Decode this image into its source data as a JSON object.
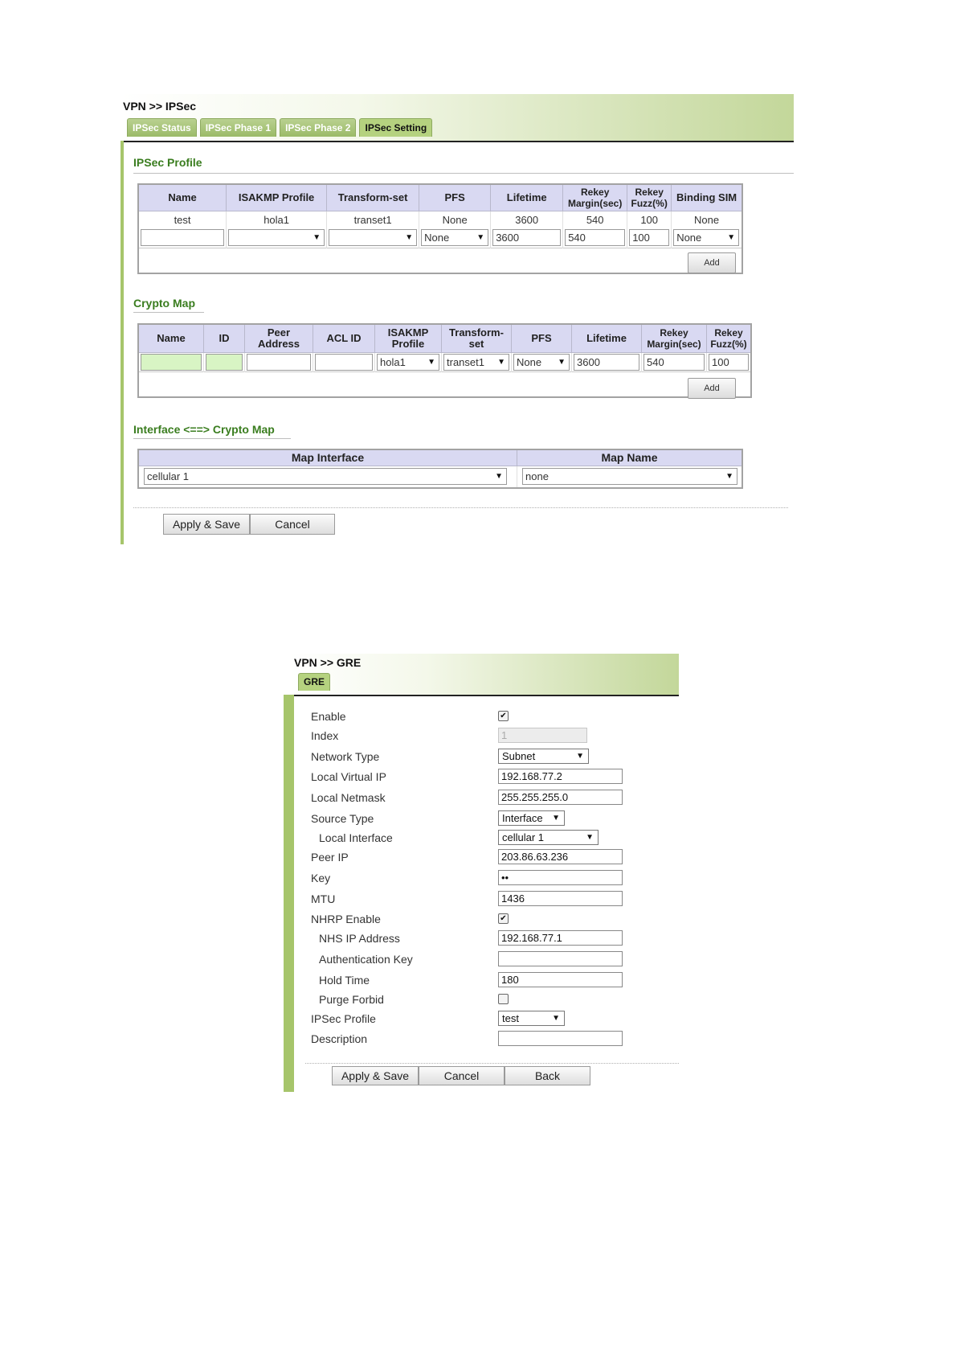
{
  "ipsec": {
    "breadcrumb": "VPN >> IPSec",
    "tabs": [
      {
        "label": "IPSec Status",
        "active": false
      },
      {
        "label": "IPSec Phase 1",
        "active": false
      },
      {
        "label": "IPSec Phase 2",
        "active": false
      },
      {
        "label": "IPSec Setting",
        "active": true
      }
    ],
    "profile": {
      "title": "IPSec Profile",
      "headers": [
        "Name",
        "ISAKMP Profile",
        "Transform-set",
        "PFS",
        "Lifetime",
        "Rekey Margin(sec)",
        "Rekey Fuzz(%)",
        "Binding SIM"
      ],
      "row": [
        "test",
        "hola1",
        "transet1",
        "None",
        "3600",
        "540",
        "100",
        "None"
      ],
      "inputs": {
        "name": "",
        "isakmp": "",
        "transform": "",
        "pfs": "None",
        "lifetime": "3600",
        "margin": "540",
        "fuzz": "100",
        "sim": "None"
      },
      "add_label": "Add"
    },
    "crypto": {
      "title": "Crypto Map",
      "headers": [
        "Name",
        "ID",
        "Peer Address",
        "ACL ID",
        "ISAKMP Profile",
        "Transform-set",
        "PFS",
        "Lifetime",
        "Rekey Margin(sec)",
        "Rekey Fuzz(%)"
      ],
      "inputs": {
        "name": "",
        "id": "",
        "peer": "",
        "acl": "",
        "isakmp": "hola1",
        "transform": "transet1",
        "pfs": "None",
        "lifetime": "3600",
        "margin": "540",
        "fuzz": "100"
      },
      "add_label": "Add"
    },
    "iface": {
      "title": "Interface <==> Crypto Map",
      "headers": [
        "Map Interface",
        "Map Name"
      ],
      "interface_value": "cellular 1",
      "map_name_value": "none"
    },
    "buttons": {
      "apply": "Apply & Save",
      "cancel": "Cancel"
    },
    "colors": {
      "accent": "#a6c56b",
      "header_bg": "#d9d9f2",
      "title_green": "#3a7d1f"
    }
  },
  "gre": {
    "breadcrumb": "VPN >> GRE",
    "tab": "GRE",
    "fields": {
      "enable": {
        "label": "Enable",
        "checked": true
      },
      "index": {
        "label": "Index",
        "value": "1"
      },
      "network_type": {
        "label": "Network Type",
        "value": "Subnet"
      },
      "local_virtual_ip": {
        "label": "Local Virtual IP",
        "value": "192.168.77.2"
      },
      "local_netmask": {
        "label": "Local Netmask",
        "value": "255.255.255.0"
      },
      "source_type": {
        "label": "Source Type",
        "value": "Interface"
      },
      "local_interface": {
        "label": "Local Interface",
        "value": "cellular 1"
      },
      "peer_ip": {
        "label": "Peer IP",
        "value": "203.86.63.236"
      },
      "key": {
        "label": "Key",
        "value": "••"
      },
      "mtu": {
        "label": "MTU",
        "value": "1436"
      },
      "nhrp_enable": {
        "label": "NHRP Enable",
        "checked": true
      },
      "nhs_ip": {
        "label": "NHS IP Address",
        "value": "192.168.77.1"
      },
      "auth_key": {
        "label": "Authentication Key",
        "value": ""
      },
      "hold_time": {
        "label": "Hold Time",
        "value": "180"
      },
      "purge_forbid": {
        "label": "Purge Forbid",
        "checked": false
      },
      "ipsec_profile": {
        "label": "IPSec Profile",
        "value": "test"
      },
      "description": {
        "label": "Description",
        "value": ""
      }
    },
    "buttons": {
      "apply": "Apply & Save",
      "cancel": "Cancel",
      "back": "Back"
    }
  }
}
